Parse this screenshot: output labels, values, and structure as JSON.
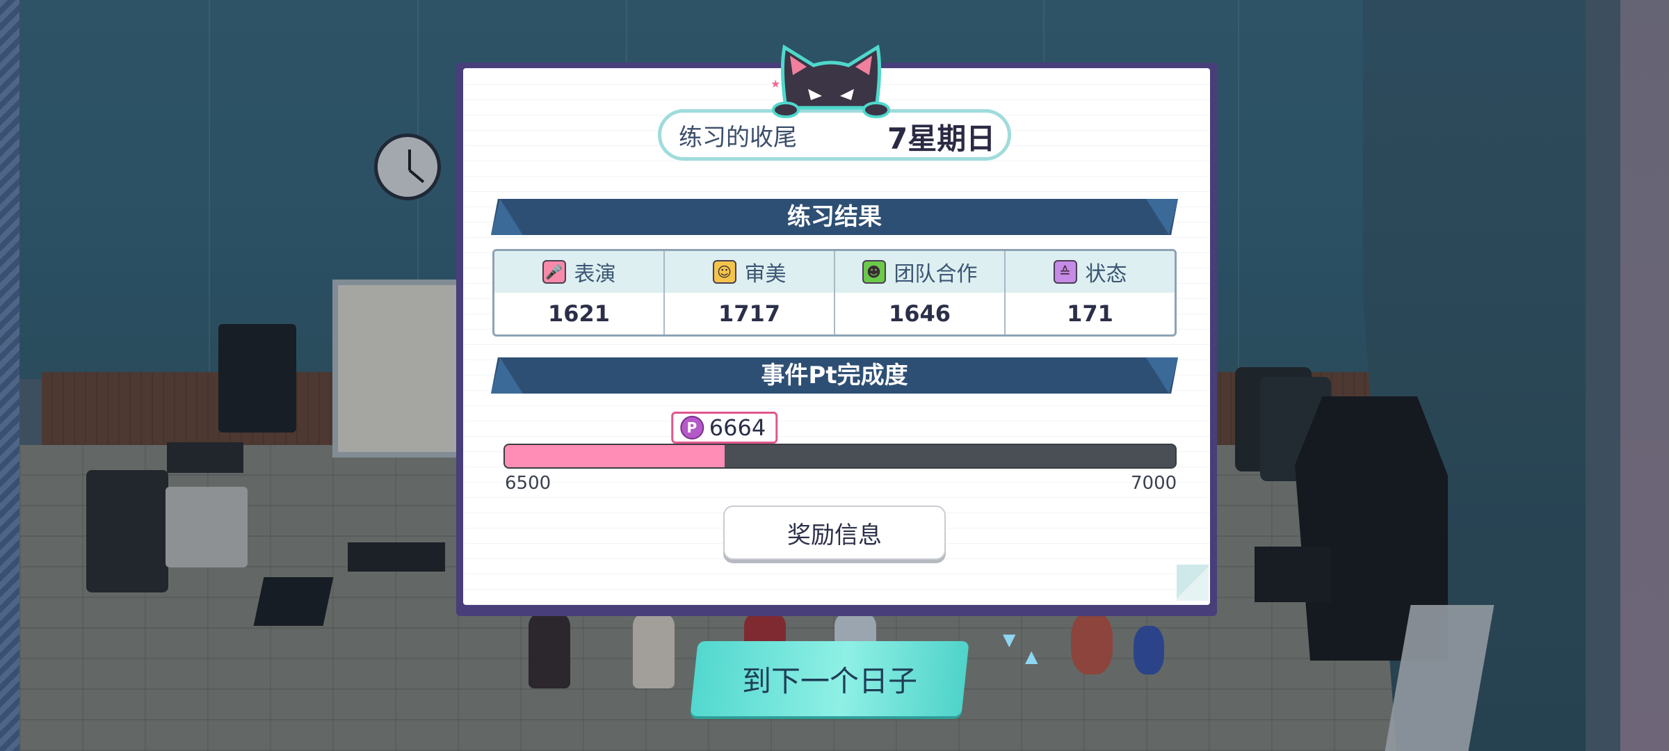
{
  "header": {
    "title": "练习的收尾",
    "date": "7星期日"
  },
  "results": {
    "title": "练习结果",
    "stats": [
      {
        "label": "表演",
        "value": "1621",
        "icon": "microphone-icon",
        "color": "#f78aa8"
      },
      {
        "label": "审美",
        "value": "1717",
        "icon": "face-icon",
        "color": "#f3c44c"
      },
      {
        "label": "团队合作",
        "value": "1646",
        "icon": "team-icon",
        "color": "#6cc94a"
      },
      {
        "label": "状态",
        "value": "171",
        "icon": "cake-icon",
        "color": "#c58be6"
      }
    ]
  },
  "event": {
    "title": "事件Pt完成度",
    "current": "6664",
    "min": "6500",
    "max": "7000",
    "current_value": 6664,
    "min_value": 6500,
    "max_value": 7000,
    "coin_letter": "P"
  },
  "buttons": {
    "reward": "奖励信息",
    "next_day": "到下一个日子"
  },
  "colors": {
    "banner": "#2e4f74",
    "progress_fill": "#ff8db5",
    "next_button": "#6fe6dc",
    "panel_border": "#473e7a"
  }
}
